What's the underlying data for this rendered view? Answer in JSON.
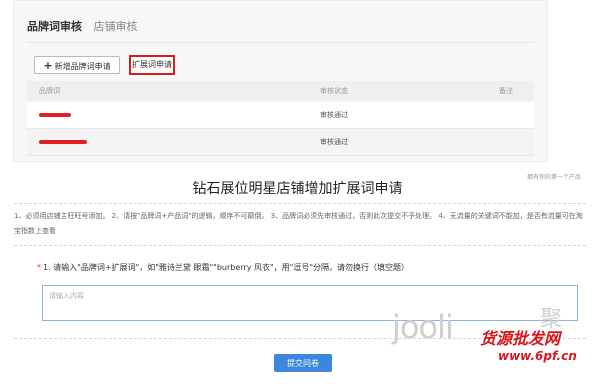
{
  "admin": {
    "tabs": [
      "品牌词审核",
      "店铺审核"
    ],
    "add_button": "新增品牌词申请",
    "expand_button": "扩展词申请",
    "columns": [
      "品牌词",
      "审核状态",
      "备注"
    ],
    "rows": [
      {
        "status": "审核通过"
      },
      {
        "status": "审核通过"
      }
    ],
    "highlight_color": "#d21e1e"
  },
  "form": {
    "top_link": "拥有你的第一个产品",
    "title": "钻石展位明星店铺增加扩展词申请",
    "instructions": "1、必须用店铺主旺旺号添加。 2、请按\"品牌词+产品词\"的逻辑，顺序不可颠倒。 3、品牌词必须先审核通过，否则此次提交不予处理。 4、无流量的关键词不能加，是否有流量可在淘宝指数上查看",
    "question": "1. 请输入\"品牌词+扩展词\"，如\"雅诗兰黛 眼霜\"\"burberry 风衣\"，用\"逗号\"分隔，请勿换行（填空题）",
    "question_required_mark": "*",
    "answer_placeholder": "请输入内容",
    "submit": "提交问卷",
    "accent_color": "#3d86dd"
  },
  "watermark": {
    "brand": "jooli",
    "brand_cn": "聚",
    "site_name": "货源批发网",
    "site_url": "www.6pf.cn"
  }
}
